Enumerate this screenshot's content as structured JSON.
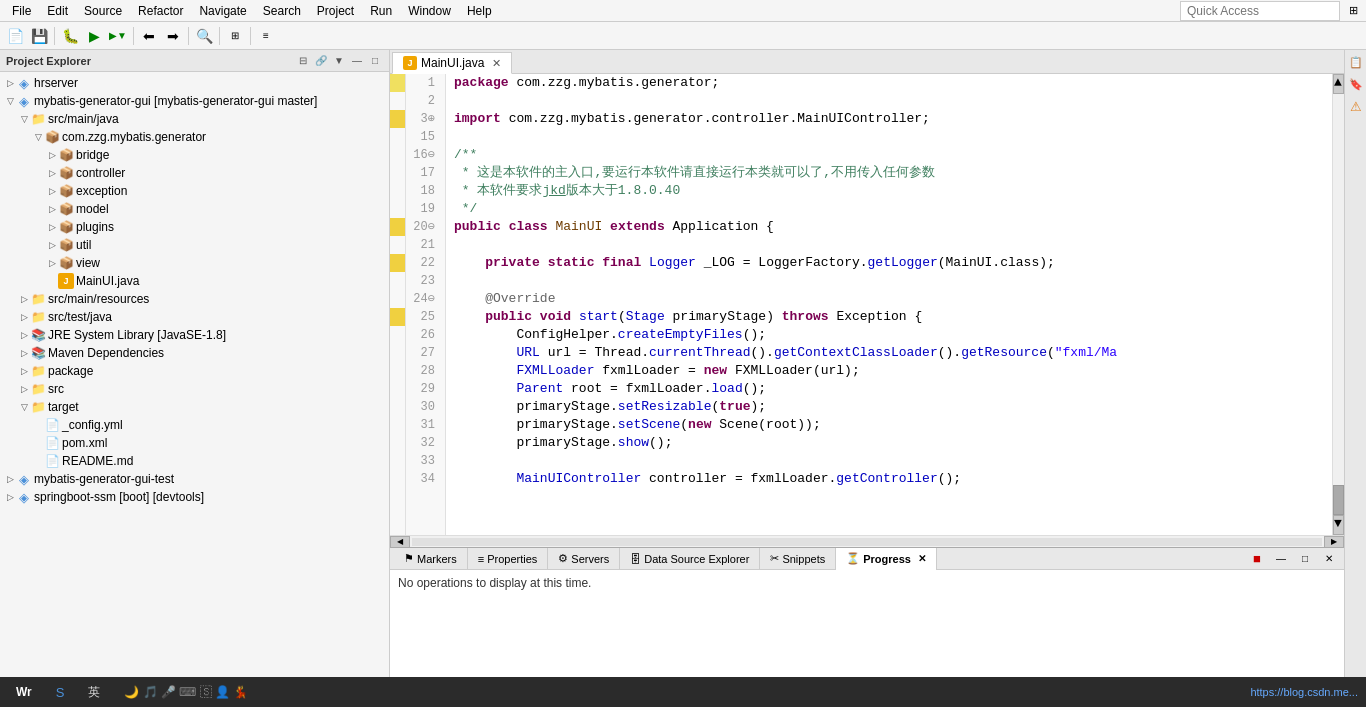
{
  "menu": {
    "items": [
      "File",
      "Edit",
      "Source",
      "Refactor",
      "Navigate",
      "Search",
      "Project",
      "Run",
      "Window",
      "Help"
    ]
  },
  "toolbar": {
    "quick_access_placeholder": "Quick Access"
  },
  "sidebar": {
    "title": "Project Explorer",
    "tree": [
      {
        "id": "hrserver",
        "label": "hrserver",
        "level": 0,
        "type": "project",
        "expanded": true
      },
      {
        "id": "mybatis-generator-gui",
        "label": "mybatis-generator-gui [mybatis-generator-gui master]",
        "level": 0,
        "type": "project",
        "expanded": true
      },
      {
        "id": "src-main-java",
        "label": "src/main/java",
        "level": 1,
        "type": "src",
        "expanded": true
      },
      {
        "id": "com.zzg.mybatis.generator",
        "label": "com.zzg.mybatis.generator",
        "level": 2,
        "type": "package",
        "expanded": true
      },
      {
        "id": "bridge",
        "label": "bridge",
        "level": 3,
        "type": "folder",
        "expanded": false
      },
      {
        "id": "controller",
        "label": "controller",
        "level": 3,
        "type": "folder",
        "expanded": false
      },
      {
        "id": "exception",
        "label": "exception",
        "level": 3,
        "type": "folder",
        "expanded": false
      },
      {
        "id": "model",
        "label": "model",
        "level": 3,
        "type": "folder",
        "expanded": false
      },
      {
        "id": "plugins",
        "label": "plugins",
        "level": 3,
        "type": "folder",
        "expanded": false
      },
      {
        "id": "util",
        "label": "util",
        "level": 3,
        "type": "folder",
        "expanded": false
      },
      {
        "id": "view",
        "label": "view",
        "level": 3,
        "type": "folder",
        "expanded": false
      },
      {
        "id": "MainUI.java",
        "label": "MainUI.java",
        "level": 3,
        "type": "java",
        "expanded": false
      },
      {
        "id": "src-main-resources",
        "label": "src/main/resources",
        "level": 1,
        "type": "src",
        "expanded": false
      },
      {
        "id": "src-test-java",
        "label": "src/test/java",
        "level": 1,
        "type": "src",
        "expanded": false
      },
      {
        "id": "JRE-System-Library",
        "label": "JRE System Library [JavaSE-1.8]",
        "level": 1,
        "type": "library",
        "expanded": false
      },
      {
        "id": "Maven-Dependencies",
        "label": "Maven Dependencies",
        "level": 1,
        "type": "library",
        "expanded": false
      },
      {
        "id": "package",
        "label": "package",
        "level": 1,
        "type": "folder",
        "expanded": false
      },
      {
        "id": "src",
        "label": "src",
        "level": 1,
        "type": "folder",
        "expanded": false
      },
      {
        "id": "target",
        "label": "target",
        "level": 1,
        "type": "folder",
        "expanded": true
      },
      {
        "id": "_config.yml",
        "label": "_config.yml",
        "level": 2,
        "type": "file",
        "expanded": false
      },
      {
        "id": "pom.xml",
        "label": "pom.xml",
        "level": 2,
        "type": "file",
        "expanded": false
      },
      {
        "id": "README.md",
        "label": "README.md",
        "level": 2,
        "type": "file",
        "expanded": false
      },
      {
        "id": "mybatis-generator-gui-test",
        "label": "mybatis-generator-gui-test",
        "level": 0,
        "type": "project",
        "expanded": false
      },
      {
        "id": "springboot-ssm",
        "label": "springboot-ssm [boot] [devtools]",
        "level": 0,
        "type": "project",
        "expanded": false
      }
    ]
  },
  "editor": {
    "tab_label": "MainUI.java",
    "tab_icon": "J",
    "lines": [
      {
        "num": 1,
        "content": "package com.zzg.mybatis.generator;",
        "type": "code"
      },
      {
        "num": 2,
        "content": "",
        "type": "blank"
      },
      {
        "num": 3,
        "content": "import com.zzg.mybatis.generator.controller.MainUIController;",
        "type": "import"
      },
      {
        "num": 15,
        "content": "",
        "type": "blank"
      },
      {
        "num": 16,
        "content": "/**",
        "type": "comment"
      },
      {
        "num": 17,
        "content": " * 这是本软件的主入口,要运行本软件请直接运行本类就可以了,不用传入任何参数",
        "type": "comment"
      },
      {
        "num": 18,
        "content": " * 本软件要求jkd版本大于1.8.0.40",
        "type": "comment"
      },
      {
        "num": 19,
        "content": " */",
        "type": "comment"
      },
      {
        "num": 20,
        "content": "public class MainUI extends Application {",
        "type": "code"
      },
      {
        "num": 21,
        "content": "",
        "type": "blank"
      },
      {
        "num": 22,
        "content": "    private static final Logger _LOG = LoggerFactory.getLogger(MainUI.class);",
        "type": "code"
      },
      {
        "num": 23,
        "content": "",
        "type": "blank"
      },
      {
        "num": 24,
        "content": "    @Override",
        "type": "annotation"
      },
      {
        "num": 25,
        "content": "    public void start(Stage primaryStage) throws Exception {",
        "type": "code"
      },
      {
        "num": 26,
        "content": "        ConfigHelper.createEmptyFiles();",
        "type": "code"
      },
      {
        "num": 27,
        "content": "        URL url = Thread.currentThread().getContextClassLoader().getResource(\"fxml/Ma",
        "type": "code"
      },
      {
        "num": 28,
        "content": "        FXMLLoader fxmlLoader = new FXMLLoader(url);",
        "type": "code"
      },
      {
        "num": 29,
        "content": "        Parent root = fxmlLoader.load();",
        "type": "code"
      },
      {
        "num": 30,
        "content": "        primaryStage.setResizable(true);",
        "type": "code"
      },
      {
        "num": 31,
        "content": "        primaryStage.setScene(new Scene(root));",
        "type": "code"
      },
      {
        "num": 32,
        "content": "        primaryStage.show();",
        "type": "code"
      },
      {
        "num": 33,
        "content": "",
        "type": "blank"
      },
      {
        "num": 34,
        "content": "        MainUIController controller = fxmlLoader.getController();",
        "type": "code"
      }
    ]
  },
  "bottom_panel": {
    "tabs": [
      "Markers",
      "Properties",
      "Servers",
      "Data Source Explorer",
      "Snippets",
      "Progress"
    ],
    "active_tab": "Progress",
    "content": "No operations to display at this time."
  },
  "status_bar": {
    "text": ""
  }
}
